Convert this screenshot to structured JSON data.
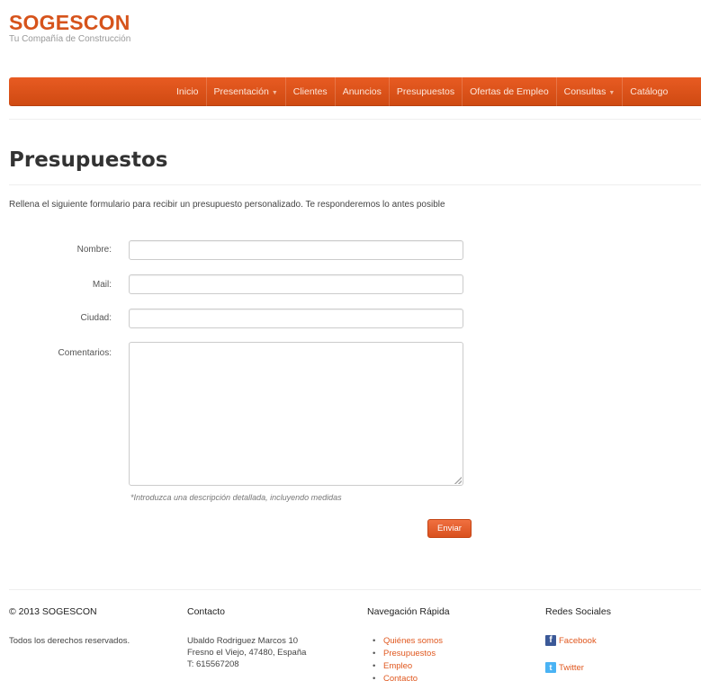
{
  "brand": {
    "logo": "SOGESCON",
    "tagline": "Tu Compañía de Construcción"
  },
  "nav": {
    "items": [
      {
        "label": "Inicio"
      },
      {
        "label": "Presentación",
        "dropdown": true
      },
      {
        "label": "Clientes"
      },
      {
        "label": "Anuncios"
      },
      {
        "label": "Presupuestos"
      },
      {
        "label": "Ofertas de Empleo"
      },
      {
        "label": "Consultas",
        "dropdown": true
      },
      {
        "label": "Catálogo"
      }
    ],
    "caret": "▼"
  },
  "page": {
    "title": "Presupuestos",
    "intro": "Rellena el siguiente formulario para recibir un presupuesto personalizado. Te responderemos lo antes posible"
  },
  "form": {
    "name_label": "Nombre:",
    "name_value": "",
    "mail_label": "Mail:",
    "mail_value": "",
    "city_label": "Ciudad:",
    "city_value": "",
    "comments_label": "Comentarios:",
    "comments_value": "",
    "hint": "*Introduzca una descripción detallada, incluyendo medidas",
    "submit_label": "Enviar"
  },
  "footer": {
    "copyright": "© 2013 SOGESCON",
    "rights": "Todos los derechos reservados.",
    "contact": {
      "title": "Contacto",
      "address_line1": "Ubaldo Rodriguez Marcos 10",
      "address_line2": "Fresno el Viejo, 47480, España",
      "phone": "T: 615567208"
    },
    "quicknav": {
      "title": "Navegación Rápida",
      "links": [
        "Quiénes somos",
        "Presupuestos",
        "Empleo",
        "Contacto"
      ]
    },
    "social": {
      "title": "Redes Sociales",
      "facebook": "Facebook",
      "twitter": "Twitter",
      "facebook_icon": "facebook-icon",
      "twitter_icon": "twitter-icon"
    }
  },
  "colors": {
    "accent": "#d6531b",
    "nav_bg": "#e04f15",
    "link": "#e0581f"
  }
}
